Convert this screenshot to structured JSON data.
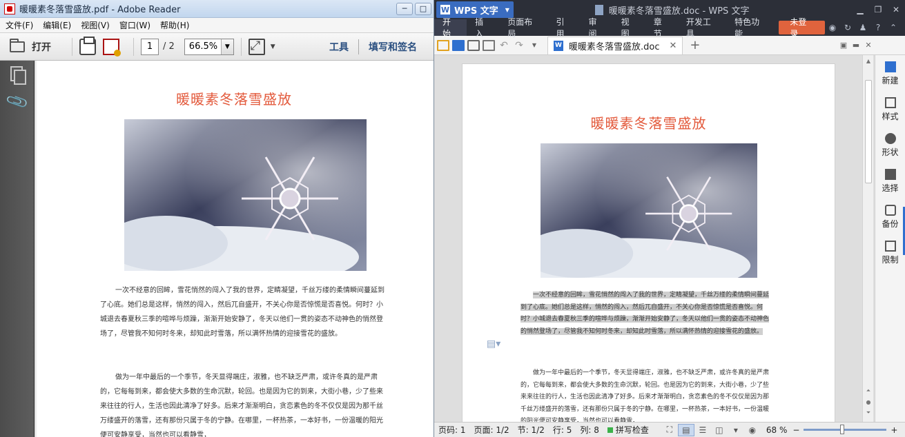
{
  "adobe": {
    "window_title": "暖暖素冬落雪盛放.pdf - Adobe Reader",
    "window_buttons": [
      "─",
      "□"
    ],
    "menus": [
      "文件(F)",
      "编辑(E)",
      "视图(V)",
      "窗口(W)",
      "帮助(H)"
    ],
    "toolbar": {
      "open_label": "打开",
      "page_current": "1",
      "page_total": "/ 2",
      "zoom": "66.5%",
      "tools_label": "工具",
      "sign_label": "填写和签名"
    },
    "document": {
      "title": "暖暖素冬落雪盛放",
      "paragraph1": "一次不经意的回眸，雪花悄然的闯入了我的世界，定睛凝望，千丝万缕的柔情瞬间蔓延到了心底。她们总是这样，悄然的闯入，然后兀自盛开，不关心你是否惊慌是否喜悦。何时？小城退去春夏秋三季的喧哗与烦躁，渐渐开始安静了，冬天以他们一贯的姿态不动神色的悄然登场了，尽管我不知何时冬来，却知此时雪落，所以满怀热情的迎接雪花的盛放。",
      "paragraph2": "做为一年中最后的一个季节，冬天显得端庄，淑雅，也不缺乏严肃，或许冬真的是严肃的，它每每到来，都会使大多数的生命沉默，轮回。也是因为它的到来，大街小巷，少了些来来往往的行人，生活也因此清净了好多。后来才渐渐明白，贪恋素色的冬不仅仅是因为那千丝万缕盛开的落雪，还有那份只属于冬的宁静。在哪里，一杯热茶，一本好书，一份温暖的阳光便可安静享受，当然也可以看静雪，"
    }
  },
  "wps": {
    "app_name": "WPS 文字",
    "window_title": "暖暖素冬落雪盛放.doc - WPS 文字",
    "ribbon_tabs": [
      "开始",
      "插入",
      "页面布局",
      "引用",
      "审阅",
      "视图",
      "章节",
      "开发工具",
      "特色功能"
    ],
    "login": "未登录",
    "doc_tab": "暖暖素冬落雪盛放.doc",
    "document": {
      "title": "暖暖素冬落雪盛放",
      "paragraph1": "一次不经意的回眸，雪花悄然的闯入了我的世界，定睛凝望，千丝万缕的柔情瞬间蔓延到了心底。她们总是这样，悄然的闯入，然后兀自盛开，不关心你是否惊慌是否喜悦。何时？小城退去春夏秋三季的喧哗与烦躁，渐渐开始安静了，冬天以他们一贯的姿态不动神色的悄然登场了，尽管我不知何时冬来，却知此时雪落，所以满怀热情的迎接雪花的盛放。",
      "paragraph2": "做为一年中最后的一个季节，冬天显得端庄，淑雅，也不缺乏严肃，或许冬真的是严肃的，它每每到来，都会使大多数的生命沉默，轮回。也是因为它的到来，大街小巷，少了些来来往往的行人，生活也因此清净了好多。后来才渐渐明白，贪恋素色的冬不仅仅是因为那千丝万缕盛开的落雪，还有那份只属于冬的宁静。在哪里，一杯热茶，一本好书，一份温暖的阳光便可安静享受，当然也可以看静雪，"
    },
    "sidebar": [
      "新建",
      "样式",
      "形状",
      "选择",
      "备份",
      "限制"
    ],
    "status": {
      "page_code": "页码: 1",
      "page": "页面: 1/2",
      "section": "节: 1/2",
      "row": "行: 5",
      "col": "列: 8",
      "spell": "拼写检查",
      "zoom": "68 %"
    }
  },
  "colors": {
    "doc_title": "#e35a3c",
    "wps_login": "#e0633d",
    "wps_accent": "#2e6fcf"
  }
}
